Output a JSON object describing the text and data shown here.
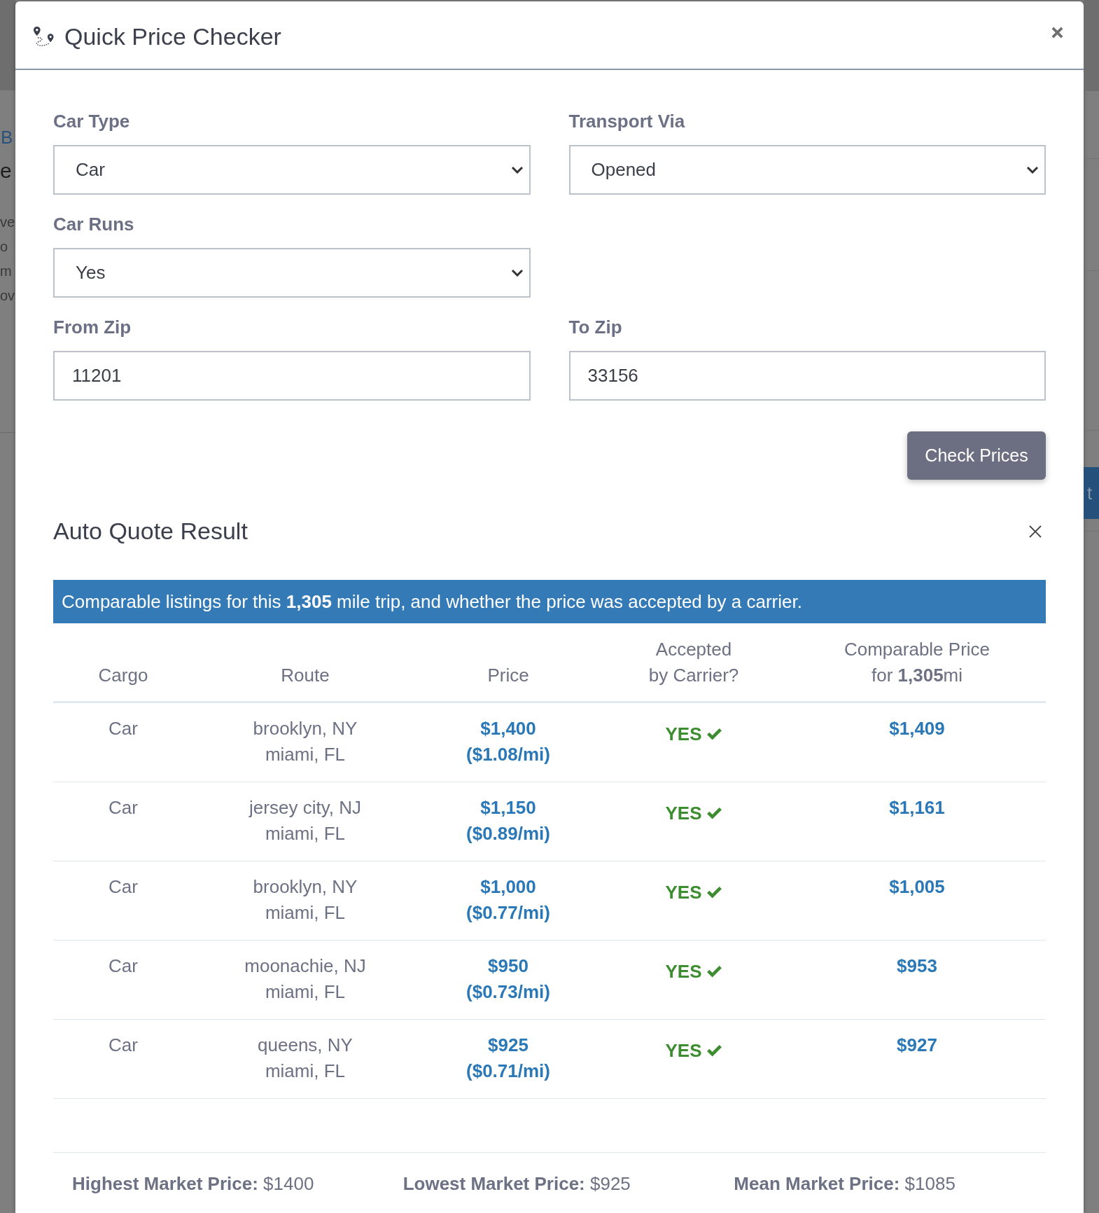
{
  "backdrop": {
    "left_texts": [
      {
        "kind": "link",
        "text": "B"
      },
      {
        "kind": "heading",
        "text": "e"
      },
      {
        "kind": "text",
        "text": "ve"
      },
      {
        "kind": "text",
        "text": "o"
      },
      {
        "kind": "text",
        "text": "m"
      },
      {
        "kind": "text",
        "text": "ov"
      }
    ],
    "right_button_text": "t"
  },
  "dialog": {
    "title": "Quick Price Checker"
  },
  "form": {
    "rows": [
      [
        {
          "kind": "select",
          "label": "Car Type",
          "value": "Car"
        },
        {
          "kind": "select",
          "label": "Transport Via",
          "value": "Opened"
        }
      ],
      [
        {
          "kind": "select",
          "label": "Car Runs",
          "value": "Yes"
        }
      ],
      [
        {
          "kind": "input",
          "label": "From Zip",
          "value": "11201"
        },
        {
          "kind": "input",
          "label": "To Zip",
          "value": "33156"
        }
      ]
    ],
    "submit_button": "Check Prices"
  },
  "result": {
    "title": "Auto Quote Result",
    "banner": "Comparable listings for this **1,305** mile trip, and whether the price was accepted by a carrier.",
    "table": {
      "columns": [
        {
          "lines": [
            "Cargo"
          ]
        },
        {
          "lines": [
            "Route"
          ]
        },
        {
          "lines": [
            "Price"
          ]
        },
        {
          "lines": [
            "Accepted",
            "by Carrier?"
          ]
        },
        {
          "lines": [
            "Comparable Price",
            "for **1,305**mi"
          ]
        }
      ],
      "rows": [
        {
          "cargo": "Car",
          "origin": "brooklyn, NY",
          "destination": "miami, FL",
          "price": "$1,400",
          "price_per_mile": "($1.08/mi)",
          "accepted": true,
          "accepted_label": "YES",
          "comparable_price": "$1,409"
        },
        {
          "cargo": "Car",
          "origin": "jersey city, NJ",
          "destination": "miami, FL",
          "price": "$1,150",
          "price_per_mile": "($0.89/mi)",
          "accepted": true,
          "accepted_label": "YES",
          "comparable_price": "$1,161"
        },
        {
          "cargo": "Car",
          "origin": "brooklyn, NY",
          "destination": "miami, FL",
          "price": "$1,000",
          "price_per_mile": "($0.77/mi)",
          "accepted": true,
          "accepted_label": "YES",
          "comparable_price": "$1,005"
        },
        {
          "cargo": "Car",
          "origin": "moonachie, NJ",
          "destination": "miami, FL",
          "price": "$950",
          "price_per_mile": "($0.73/mi)",
          "accepted": true,
          "accepted_label": "YES",
          "comparable_price": "$953"
        },
        {
          "cargo": "Car",
          "origin": "queens, NY",
          "destination": "miami, FL",
          "price": "$925",
          "price_per_mile": "($0.71/mi)",
          "accepted": true,
          "accepted_label": "YES",
          "comparable_price": "$927"
        }
      ]
    },
    "market_stats": [
      "**Highest Market Price:** $1400",
      "**Lowest Market Price:** $925",
      "**Mean Market Price:** $1085"
    ]
  }
}
